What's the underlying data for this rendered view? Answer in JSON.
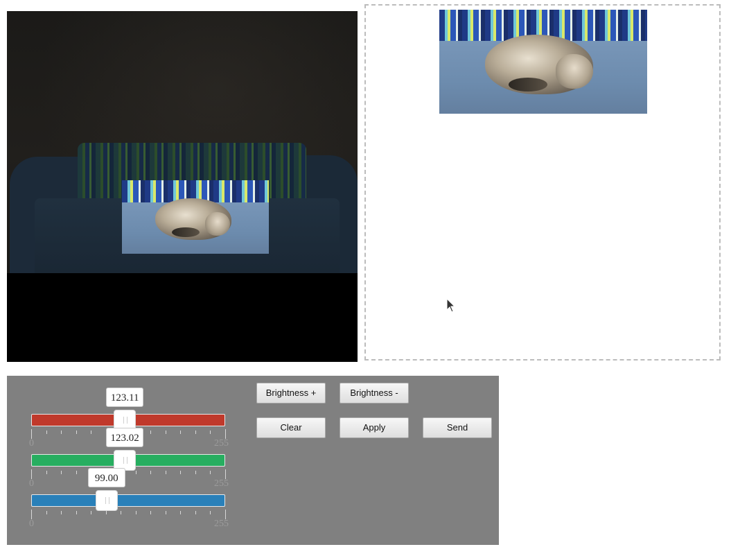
{
  "canvas": {
    "photo_alt": "Sleeping cat on a blue sofa"
  },
  "preview": {
    "photo_alt": "Sleeping cat on a blue sofa"
  },
  "sliders": [
    {
      "name": "red",
      "value": 123.11,
      "value_label": "123.11",
      "min": 0,
      "max": 255,
      "min_label": "0",
      "max_label": "255",
      "color": "#c0392b"
    },
    {
      "name": "green",
      "value": 123.02,
      "value_label": "123.02",
      "min": 0,
      "max": 255,
      "min_label": "0",
      "max_label": "255",
      "color": "#27ae60"
    },
    {
      "name": "blue",
      "value": 99.0,
      "value_label": "99.00",
      "min": 0,
      "max": 255,
      "min_label": "0",
      "max_label": "255",
      "color": "#2980b9"
    }
  ],
  "buttons": {
    "brightness_plus": "Brightness +",
    "brightness_minus": "Brightness -",
    "clear": "Clear",
    "apply": "Apply",
    "send": "Send"
  }
}
